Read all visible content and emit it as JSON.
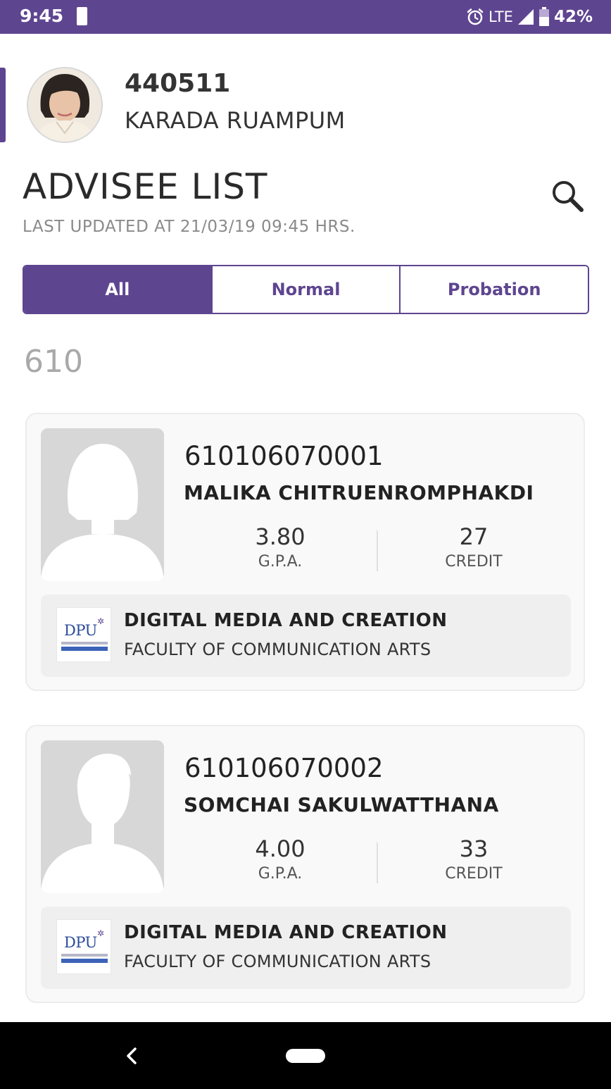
{
  "status_bar": {
    "time": "9:45",
    "network": "LTE",
    "battery": "42%",
    "icons": [
      "sim-card-icon",
      "alarm-icon",
      "signal-icon",
      "battery-icon"
    ]
  },
  "profile": {
    "id": "440511",
    "name": "KARADA RUAMPUM",
    "avatar_icon": "profile-photo"
  },
  "page": {
    "title": "ADVISEE LIST",
    "last_updated": "LAST UPDATED AT 21/03/19 09:45 HRS.",
    "search_icon": "search-icon"
  },
  "filter_tabs": [
    {
      "label": "All",
      "active": true
    },
    {
      "label": "Normal",
      "active": false
    },
    {
      "label": "Probation",
      "active": false
    }
  ],
  "group_heading": "610",
  "advisees": [
    {
      "student_id": "610106070001",
      "name": "MALIKA CHITRUENROMPHAKDI",
      "gpa": "3.80",
      "gpa_label": "G.P.A.",
      "credit": "27",
      "credit_label": "CREDIT",
      "program": "DIGITAL MEDIA AND CREATION",
      "faculty": "FACULTY OF COMMUNICATION ARTS",
      "logo_text": "DPU",
      "avatar_icon": "female-avatar-placeholder"
    },
    {
      "student_id": "610106070002",
      "name": "SOMCHAI SAKULWATTHANA",
      "gpa": "4.00",
      "gpa_label": "G.P.A.",
      "credit": "33",
      "credit_label": "CREDIT",
      "program": "DIGITAL MEDIA AND CREATION",
      "faculty": "FACULTY OF COMMUNICATION ARTS",
      "logo_text": "DPU",
      "avatar_icon": "male-avatar-placeholder"
    }
  ],
  "nav_bar": {
    "icons": [
      "back-icon",
      "home-icon"
    ]
  },
  "colors": {
    "primary": "#5e4590",
    "card_bg": "#f9f9f9",
    "muted_text": "#8a8a8a"
  }
}
